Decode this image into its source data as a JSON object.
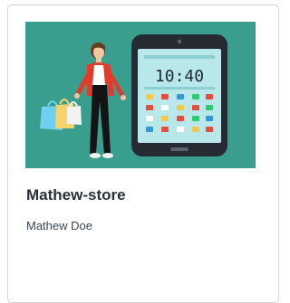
{
  "store_card": {
    "name": "Mathew-store",
    "owner": "Mathew Doe",
    "thumbnail": {
      "background_color": "#3a9e8e",
      "phone_time": "10:40",
      "icons": [
        "shopper-figure",
        "shopping-bags",
        "smartphone",
        "app-icons"
      ]
    }
  }
}
